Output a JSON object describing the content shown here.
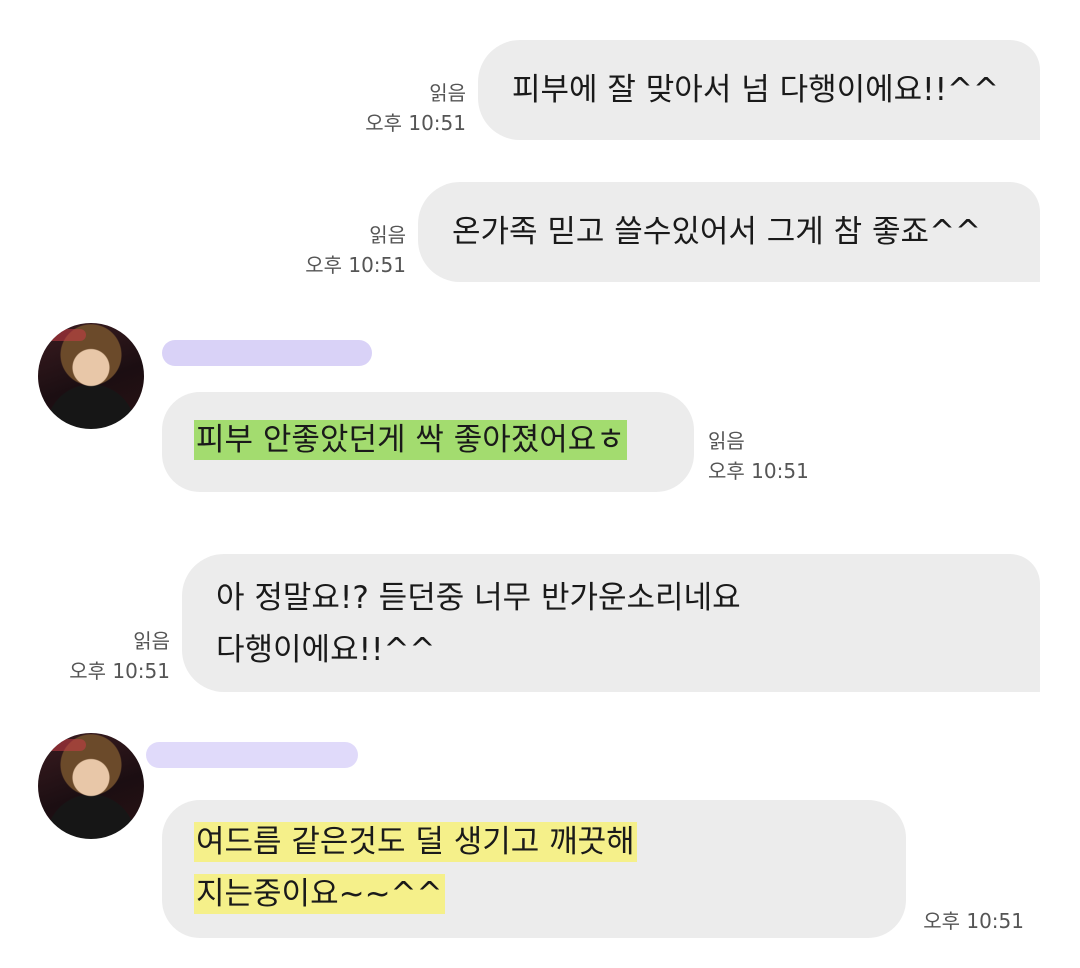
{
  "messages": [
    {
      "direction": "out",
      "text": "피부에 잘 맞아서 넘 다행이에요!!^^",
      "read": "읽음",
      "time": "오후 10:51"
    },
    {
      "direction": "out",
      "text": "온가족 믿고 쓸수있어서 그게 참 좋죠^^",
      "read": "읽음",
      "time": "오후 10:51"
    },
    {
      "direction": "in",
      "sender": "",
      "text": "피부 안좋았던게 싹 좋아졌어요ㅎ",
      "highlight_color": "#a3dc6f",
      "read": "읽음",
      "time": "오후 10:51"
    },
    {
      "direction": "out",
      "lines": [
        "아 정말요!? 듣던중 너무 반가운소리네요",
        "다행이에요!!^^"
      ],
      "read": "읽음",
      "time": "오후 10:51"
    },
    {
      "direction": "in",
      "sender": "",
      "lines": [
        "여드름 같은것도 덜 생기고 깨끗해",
        "지는중이요~~^^"
      ],
      "highlight_color": "#f5f08a",
      "time": "오후 10:51"
    }
  ],
  "colors": {
    "bubble": "#ececec",
    "name_redaction": "#d5cdf6",
    "meta_text": "#555555"
  }
}
